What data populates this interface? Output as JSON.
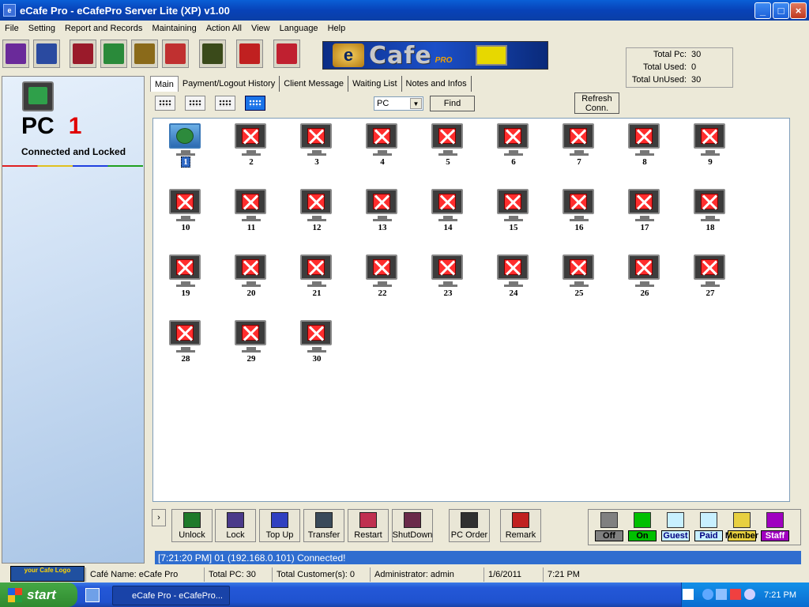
{
  "window": {
    "title": "eCafe Pro - eCafePro Server Lite (XP) v1.00"
  },
  "menu": [
    "File",
    "Setting",
    "Report and Records",
    "Maintaining",
    "Action All",
    "View",
    "Language",
    "Help"
  ],
  "toolbar": {
    "icons": [
      "money-icon",
      "clock-icon",
      "network-icon",
      "users-icon",
      "drinks-icon",
      "help-icon",
      "money-bag-icon",
      "first-aid-icon",
      "lock-icon"
    ]
  },
  "banner": {
    "e": "e",
    "word": "Cafe",
    "pro": "PRO"
  },
  "stats": [
    {
      "label": "Total Pc:",
      "value": "30"
    },
    {
      "label": "Total Used:",
      "value": "0"
    },
    {
      "label": "Total UnUsed:",
      "value": "30"
    }
  ],
  "selected_pc": {
    "prefix": "PC",
    "number": "1",
    "status": "Connected and Locked"
  },
  "tabs": [
    "Main",
    "Payment/Logout History",
    "Client Message",
    "Waiting List",
    "Notes and Infos"
  ],
  "filter": {
    "selected": "PC",
    "find_label": "Find",
    "refresh_label": "Refresh Conn."
  },
  "pcs": [
    {
      "label": "1",
      "state": "on"
    },
    {
      "label": "2",
      "state": "off"
    },
    {
      "label": "3",
      "state": "off"
    },
    {
      "label": "4",
      "state": "off"
    },
    {
      "label": "5",
      "state": "off"
    },
    {
      "label": "6",
      "state": "off"
    },
    {
      "label": "7",
      "state": "off"
    },
    {
      "label": "8",
      "state": "off"
    },
    {
      "label": "9",
      "state": "off"
    },
    {
      "label": "10",
      "state": "off"
    },
    {
      "label": "11",
      "state": "off"
    },
    {
      "label": "12",
      "state": "off"
    },
    {
      "label": "13",
      "state": "off"
    },
    {
      "label": "14",
      "state": "off"
    },
    {
      "label": "15",
      "state": "off"
    },
    {
      "label": "16",
      "state": "off"
    },
    {
      "label": "17",
      "state": "off"
    },
    {
      "label": "18",
      "state": "off"
    },
    {
      "label": "19",
      "state": "off"
    },
    {
      "label": "20",
      "state": "off"
    },
    {
      "label": "21",
      "state": "off"
    },
    {
      "label": "22",
      "state": "off"
    },
    {
      "label": "23",
      "state": "off"
    },
    {
      "label": "24",
      "state": "off"
    },
    {
      "label": "25",
      "state": "off"
    },
    {
      "label": "26",
      "state": "off"
    },
    {
      "label": "27",
      "state": "off"
    },
    {
      "label": "28",
      "state": "off"
    },
    {
      "label": "29",
      "state": "off"
    },
    {
      "label": "30",
      "state": "off"
    }
  ],
  "actions": [
    {
      "label": "Unlock",
      "color": "#1e7a2a"
    },
    {
      "label": "Lock",
      "color": "#4a3a8a"
    },
    {
      "label": "Top Up",
      "color": "#3040c0"
    },
    {
      "label": "Transfer",
      "color": "#3a4a5a"
    },
    {
      "label": "Restart",
      "color": "#c03050"
    },
    {
      "label": "ShutDown",
      "color": "#6a2a4a"
    },
    {
      "label": "PC Order",
      "color": "#303030"
    },
    {
      "label": "Remark",
      "color": "#c02020"
    }
  ],
  "legend": [
    {
      "label": "Off",
      "bg": "#808080",
      "fg": "#000000"
    },
    {
      "label": "On",
      "bg": "#00c000",
      "fg": "#000000"
    },
    {
      "label": "Guest",
      "bg": "#c8f0ff",
      "fg": "#000080"
    },
    {
      "label": "Paid",
      "bg": "#c8f0ff",
      "fg": "#000080"
    },
    {
      "label": "Member",
      "bg": "#e8d040",
      "fg": "#000000"
    },
    {
      "label": "Staff",
      "bg": "#a000c0",
      "fg": "#ffffff"
    }
  ],
  "status_message": "[7:21:20 PM] 01 (192.168.0.101) Connected!",
  "logo_text": "your Cafe Logo",
  "statusbar": {
    "cafe": "Café Name: eCafe Pro",
    "total_pc": "Total PC: 30",
    "customers": "Total Customer(s): 0",
    "admin": "Administrator: admin",
    "date": "1/6/2011",
    "time": "7:21 PM"
  },
  "taskbar": {
    "start": "start",
    "item": "eCafe Pro - eCafePro...",
    "clock": "7:21 PM"
  }
}
